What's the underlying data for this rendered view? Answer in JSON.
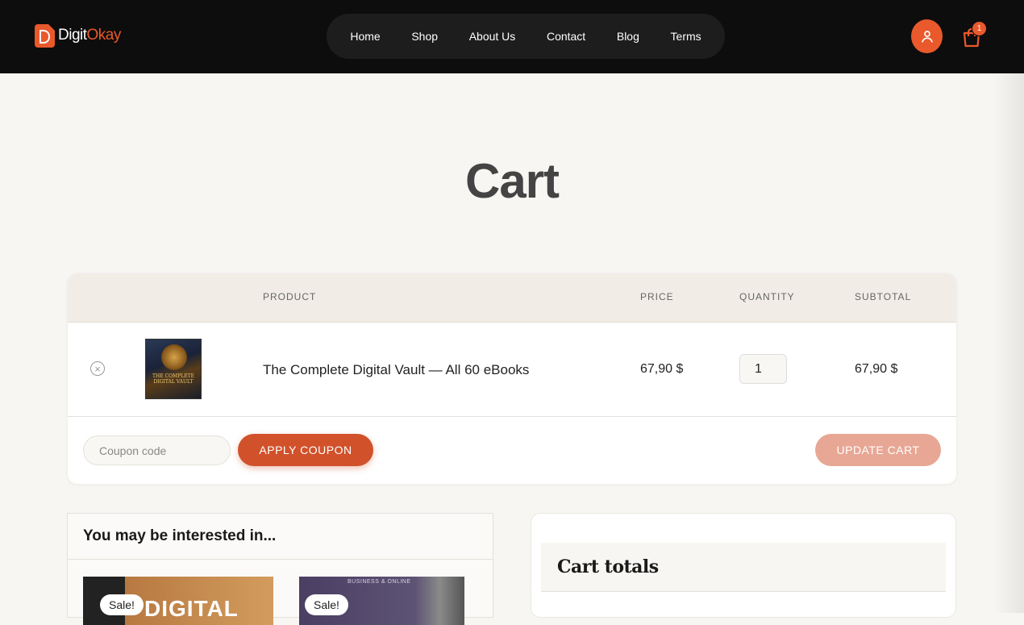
{
  "header": {
    "logo": {
      "part1": "Digit",
      "part2": "Okay",
      "mark": "D"
    },
    "nav": [
      {
        "label": "Home"
      },
      {
        "label": "Shop"
      },
      {
        "label": "About Us"
      },
      {
        "label": "Contact"
      },
      {
        "label": "Blog"
      },
      {
        "label": "Terms"
      }
    ],
    "cart_count": "1",
    "icons": {
      "user": "user-icon",
      "cart": "shopping-bag-icon"
    },
    "colors": {
      "accent": "#e9592c",
      "topbar": "#0d0d0d"
    }
  },
  "page": {
    "title": "Cart"
  },
  "cart": {
    "columns": {
      "product": "PRODUCT",
      "price": "PRICE",
      "quantity": "QUANTITY",
      "subtotal": "SUBTOTAL"
    },
    "items": [
      {
        "name": "The Complete Digital Vault — All 60 eBooks",
        "price": "67,90 $",
        "quantity": "1",
        "subtotal": "67,90 $",
        "thumb_text": "THE COMPLETE DIGITAL VAULT"
      }
    ],
    "coupon_placeholder": "Coupon code",
    "apply_label": "APPLY COUPON",
    "update_label": "UPDATE CART",
    "colors": {
      "apply": "#d1512b",
      "update": "#e8a794"
    }
  },
  "interest": {
    "title": "You may be interested in...",
    "products": [
      {
        "badge": "Sale!",
        "cover_text": "DIGITAL"
      },
      {
        "badge": "Sale!",
        "cover_text": "BUSINESS & ONLINE"
      }
    ]
  },
  "totals": {
    "title": "Cart totals"
  }
}
